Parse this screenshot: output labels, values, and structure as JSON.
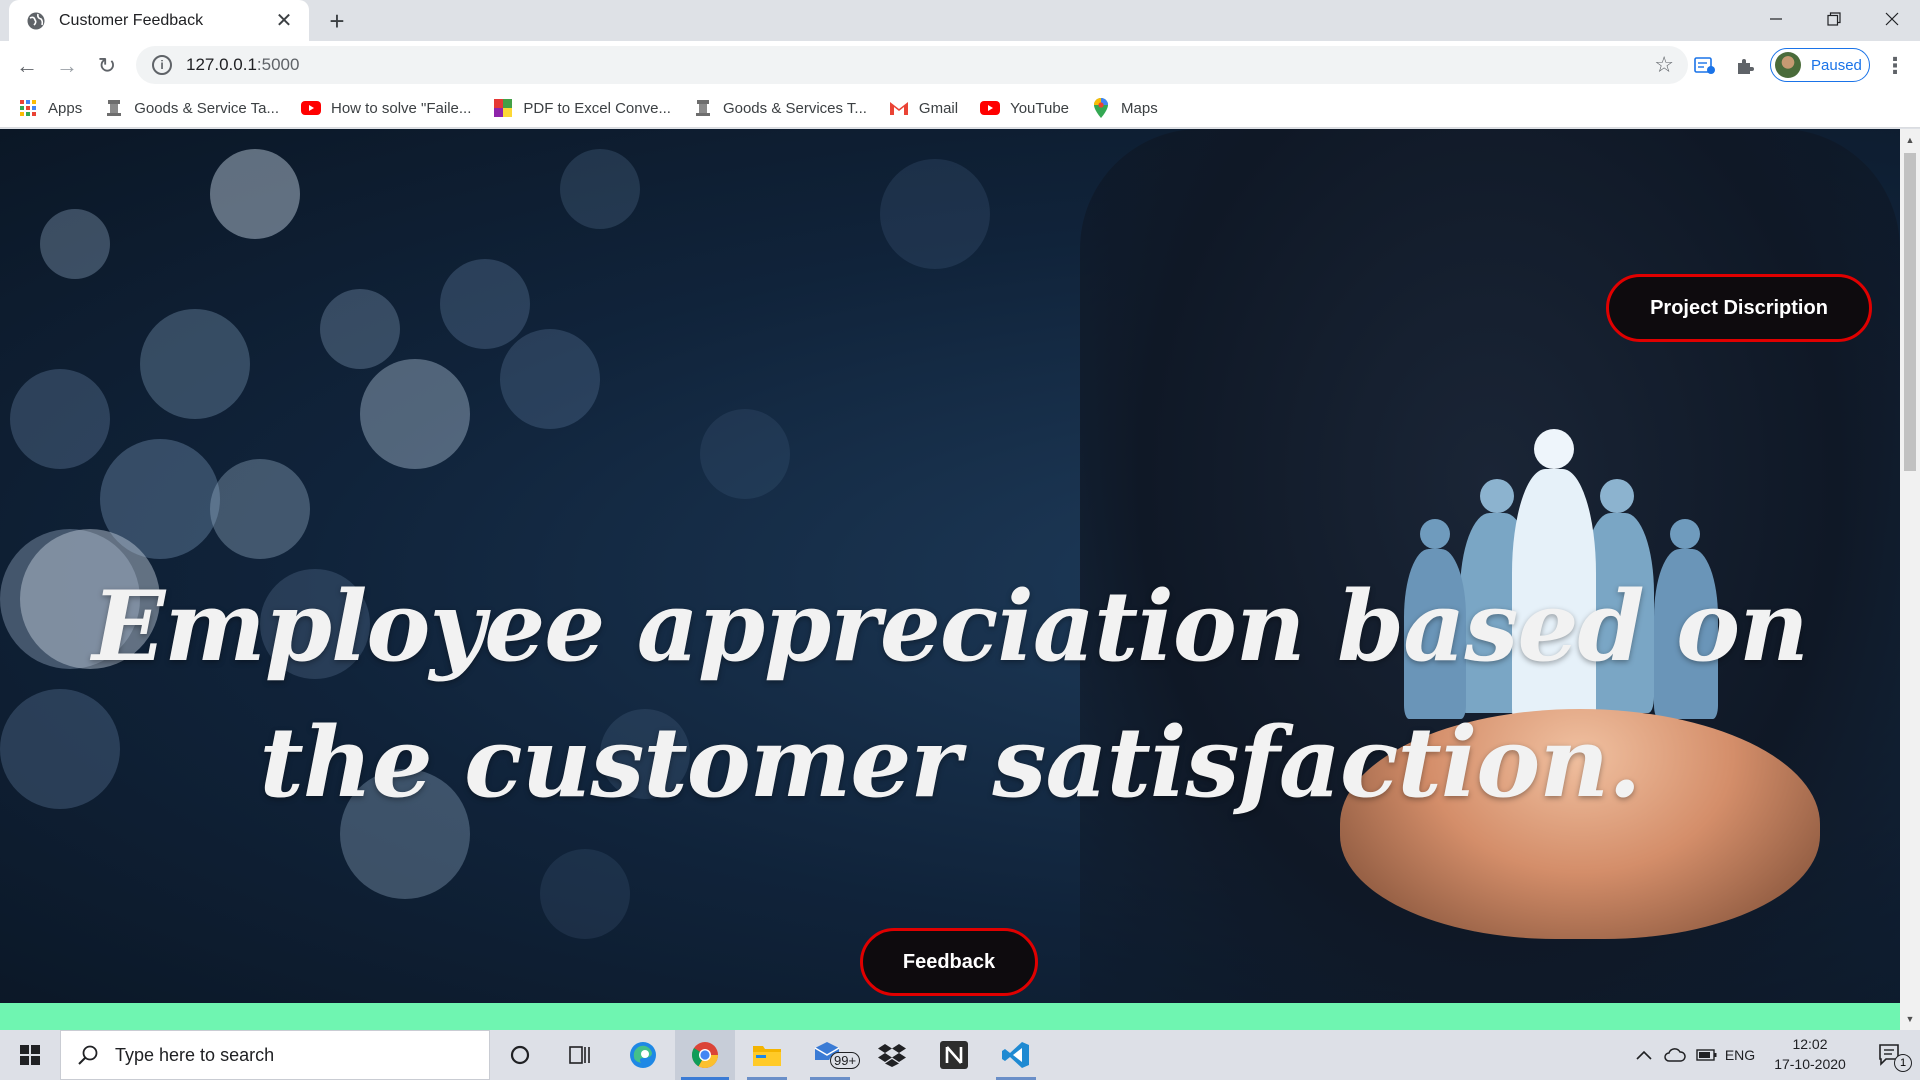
{
  "browser": {
    "tab": {
      "title": "Customer Feedback",
      "close": "✕"
    },
    "new_tab": "+",
    "window_controls": {
      "minimize": "—",
      "restore": "❐",
      "close": "✕"
    },
    "nav": {
      "back": "←",
      "forward": "→",
      "reload": "↻"
    },
    "address": {
      "host": "127.0.0.1",
      "port": ":5000",
      "info": "i",
      "star": "☆"
    },
    "profile": {
      "label": "Paused"
    },
    "menu": "⋮",
    "bookmarks": [
      {
        "label": "Apps",
        "icon": "apps-grid-icon"
      },
      {
        "label": "Goods & Service Ta...",
        "icon": "gov-emblem-icon"
      },
      {
        "label": "How to solve \"Faile...",
        "icon": "youtube-icon"
      },
      {
        "label": "PDF to Excel Conve...",
        "icon": "pdf-converter-icon"
      },
      {
        "label": "Goods & Services T...",
        "icon": "gov-emblem-icon"
      },
      {
        "label": "Gmail",
        "icon": "gmail-icon"
      },
      {
        "label": "YouTube",
        "icon": "youtube-icon"
      },
      {
        "label": "Maps",
        "icon": "maps-pin-icon"
      }
    ]
  },
  "page": {
    "hero_title": "Employee appreciation based on the customer satisfaction.",
    "project_button": "Project Discription",
    "feedback_button": "Feedback",
    "colors": {
      "button_bg": "#0e0b0e",
      "button_border": "#e00000",
      "footer_band": "#6ff5b1",
      "hero_text": "#f2f2f2"
    }
  },
  "taskbar": {
    "search_placeholder": "Type here to search",
    "mail_badge": "99+",
    "language": "ENG",
    "time": "12:02",
    "date": "17-10-2020",
    "notification_count": "1",
    "apps": [
      "cortana-icon",
      "task-view-icon",
      "edge-icon",
      "chrome-icon",
      "file-explorer-icon",
      "mail-icon",
      "dropbox-icon",
      "notion-icon",
      "vscode-icon"
    ]
  }
}
